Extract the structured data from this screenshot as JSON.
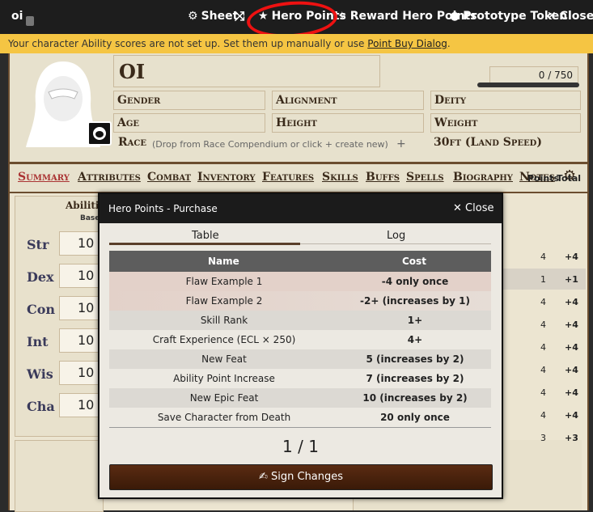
{
  "topbar": {
    "title": "oi",
    "sheet": "Sheet",
    "hero_points": "Hero Points",
    "reward": "Reward Hero Points",
    "prototype": "Prototype Token",
    "close": "Close"
  },
  "warning": {
    "text": "Your character Ability scores are not set up. Set them up manually or use",
    "link": "Point Buy Dialog",
    "end": "."
  },
  "header": {
    "name": "OI",
    "xp": "0 / 750",
    "gender": "Gender",
    "alignment": "Alignment",
    "deity": "Deity",
    "age": "Age",
    "height": "Height",
    "weight": "Weight",
    "race": "Race",
    "race_hint": "(Drop from Race Compendium or click + create new)",
    "race_plus": "+",
    "speed": "30ft (Land Speed)"
  },
  "tabs": [
    "Summary",
    "Attributes",
    "Combat",
    "Inventory",
    "Features",
    "Skills",
    "Buffs",
    "Spells",
    "Biography",
    "Notes"
  ],
  "abilities": {
    "header": "Abiliti",
    "base": "Base",
    "rows": [
      {
        "label": "Str",
        "value": "10"
      },
      {
        "label": "Dex",
        "value": "10"
      },
      {
        "label": "Con",
        "value": "10"
      },
      {
        "label": "Int",
        "value": "10"
      },
      {
        "label": "Wis",
        "value": "10"
      },
      {
        "label": "Cha",
        "value": "10"
      }
    ]
  },
  "right": {
    "points_header": "Points",
    "total_header": "Total",
    "rows": [
      {
        "points": "4",
        "total": "+4"
      },
      {
        "points": "1",
        "total": "+1"
      },
      {
        "points": "4",
        "total": "+4"
      },
      {
        "points": "4",
        "total": "+4"
      },
      {
        "points": "4",
        "total": "+4"
      },
      {
        "points": "4",
        "total": "+4"
      },
      {
        "points": "4",
        "total": "+4"
      },
      {
        "points": "4",
        "total": "+4"
      },
      {
        "points": "3",
        "total": "+3"
      }
    ]
  },
  "modal": {
    "title": "Hero Points - Purchase",
    "close": "Close",
    "tab_table": "Table",
    "tab_log": "Log",
    "col_name": "Name",
    "col_cost": "Cost",
    "rows": [
      {
        "name": "Flaw Example 1",
        "cost": "-4 only once"
      },
      {
        "name": "Flaw Example 2",
        "cost": "-2+ (increases by 1)"
      },
      {
        "name": "Skill Rank",
        "cost": "1+"
      },
      {
        "name": "Craft Experience (ECL × 250)",
        "cost": "4+"
      },
      {
        "name": "New Feat",
        "cost": "5 (increases by 2)"
      },
      {
        "name": "Ability Point Increase",
        "cost": "7 (increases by 2)"
      },
      {
        "name": "New Epic Feat",
        "cost": "10 (increases by 2)"
      },
      {
        "name": "Save Character from Death",
        "cost": "20 only once"
      }
    ],
    "pager": "1 / 1",
    "sign": "Sign Changes"
  }
}
